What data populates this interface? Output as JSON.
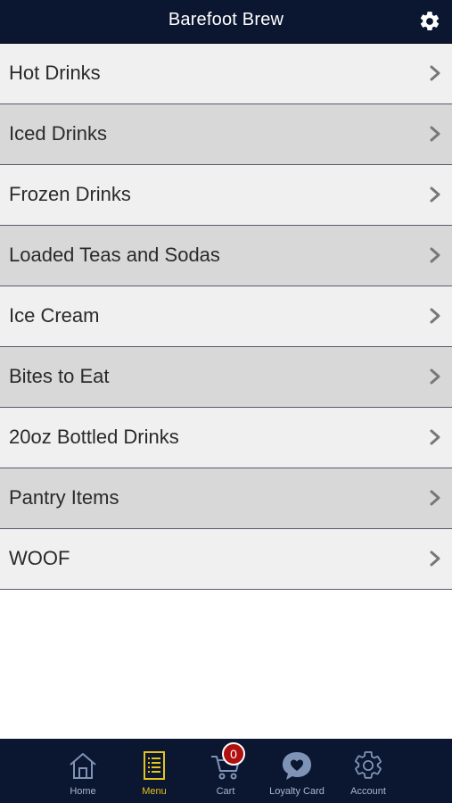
{
  "header": {
    "title": "Barefoot Brew",
    "settings_icon": "gear-icon"
  },
  "menu": {
    "categories": [
      {
        "label": "Hot Drinks"
      },
      {
        "label": "Iced Drinks"
      },
      {
        "label": "Frozen Drinks"
      },
      {
        "label": "Loaded Teas and Sodas"
      },
      {
        "label": "Ice Cream"
      },
      {
        "label": "Bites to Eat"
      },
      {
        "label": "20oz Bottled Drinks"
      },
      {
        "label": "Pantry Items"
      },
      {
        "label": "WOOF"
      }
    ]
  },
  "tabbar": {
    "tabs": [
      {
        "label": "Home",
        "icon": "home-icon"
      },
      {
        "label": "Menu",
        "icon": "menu-list-icon",
        "active": true
      },
      {
        "label": "Cart",
        "icon": "cart-icon",
        "badge": "0"
      },
      {
        "label": "Loyalty Card",
        "icon": "heart-chat-icon"
      },
      {
        "label": "Account",
        "icon": "gear-icon"
      }
    ]
  },
  "colors": {
    "header_bg": "#0b1630",
    "row_light": "#f0f0f0",
    "row_dark": "#d8d8d8",
    "active_tab": "#e6c21c",
    "inactive_tab": "#a9b7cf",
    "badge": "#b01010"
  }
}
